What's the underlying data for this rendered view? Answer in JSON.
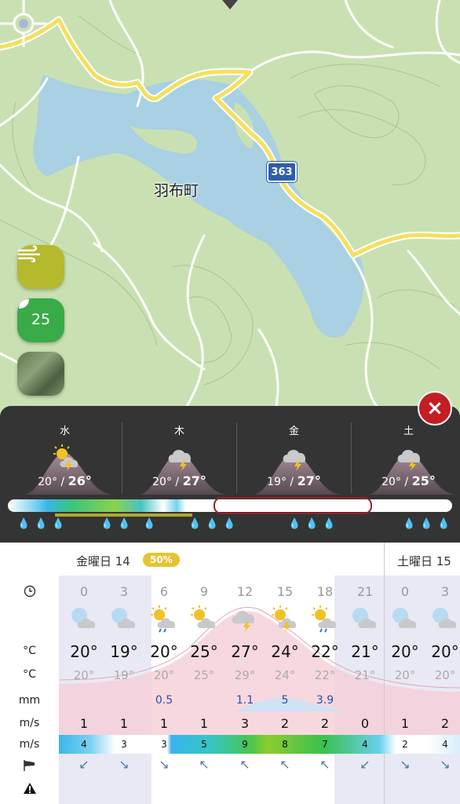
{
  "map": {
    "place_label": "羽布町",
    "route_number": "363"
  },
  "side_buttons": {
    "wind_icon": "wind-icon",
    "aqi_value": "25"
  },
  "close_icon": "×",
  "days": [
    {
      "name": "水",
      "low": "20°",
      "high": "26°",
      "icon": "sun-cloud-thunder"
    },
    {
      "name": "木",
      "low": "20°",
      "high": "27°",
      "icon": "cloud-thunder"
    },
    {
      "name": "金",
      "low": "19°",
      "high": "27°",
      "icon": "cloud-thunder"
    },
    {
      "name": "土",
      "low": "20°",
      "high": "25°",
      "icon": "cloud-thunder"
    }
  ],
  "table": {
    "labels": {
      "clock": "clock-icon",
      "temp": "°C",
      "feels": "°C",
      "rain": "mm",
      "wind": "m/s",
      "gust": "m/s",
      "dir": "windsock-icon",
      "warn": "warning-icon"
    },
    "day1_label": "金曜日 14",
    "day1_pct": "50%",
    "day2_label": "土曜日 15",
    "hours": [
      {
        "h": "0",
        "icon": "moon-cloud",
        "t": "20°",
        "f": "20°",
        "rain": "",
        "wind": "1",
        "gust": "4",
        "dir": "↙"
      },
      {
        "h": "3",
        "icon": "moon-cloud",
        "t": "19°",
        "f": "19°",
        "rain": "",
        "wind": "1",
        "gust": "3",
        "dir": "↘"
      },
      {
        "h": "6",
        "icon": "sun-cloud-rain",
        "t": "20°",
        "f": "20°",
        "rain": "0.5",
        "wind": "1",
        "gust": "3",
        "dir": "↘"
      },
      {
        "h": "9",
        "icon": "sun-cloud",
        "t": "25°",
        "f": "25°",
        "rain": "",
        "wind": "1",
        "gust": "5",
        "dir": "↖"
      },
      {
        "h": "12",
        "icon": "cloud-thunder",
        "t": "27°",
        "f": "29°",
        "rain": "1.1",
        "wind": "3",
        "gust": "9",
        "dir": "↖"
      },
      {
        "h": "15",
        "icon": "sun-cloud-thunder",
        "t": "24°",
        "f": "24°",
        "rain": "5",
        "wind": "2",
        "gust": "8",
        "dir": "↖"
      },
      {
        "h": "18",
        "icon": "sun-cloud-rain",
        "t": "22°",
        "f": "22°",
        "rain": "3.9",
        "wind": "2",
        "gust": "7",
        "dir": "↖"
      },
      {
        "h": "21",
        "icon": "moon-cloud",
        "t": "21°",
        "f": "21°",
        "rain": "",
        "wind": "0",
        "gust": "4",
        "dir": "↙"
      },
      {
        "h": "0",
        "icon": "moon-cloud",
        "t": "20°",
        "f": "20°",
        "rain": "",
        "wind": "1",
        "gust": "2",
        "dir": "↘"
      },
      {
        "h": "3",
        "icon": "moon-cloud",
        "t": "20°",
        "f": "20°",
        "rain": "",
        "wind": "2",
        "gust": "4",
        "dir": "↘"
      }
    ]
  }
}
